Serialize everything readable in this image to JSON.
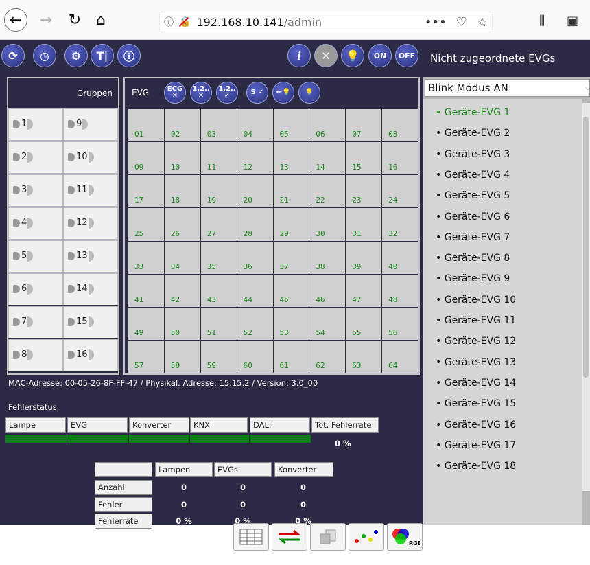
{
  "browser": {
    "url_host": "192.168.10.141",
    "url_path": "/admin",
    "actions": [
      "•••",
      "♡",
      "☆"
    ]
  },
  "toolbar": {
    "on_label": "ON",
    "off_label": "OFF",
    "info_label": "i"
  },
  "groups": {
    "header": "Gruppen",
    "items": [
      "1",
      "2",
      "3",
      "4",
      "5",
      "6",
      "7",
      "8",
      "9",
      "10",
      "11",
      "12",
      "13",
      "14",
      "15",
      "16"
    ]
  },
  "evg": {
    "label": "EVG",
    "tools": [
      "ECG ✕",
      "1,2.. ✕",
      "1,2.. ✓",
      "S ✓",
      "←💡",
      "💡"
    ],
    "cells": [
      "01",
      "02",
      "03",
      "04",
      "05",
      "06",
      "07",
      "08",
      "09",
      "10",
      "11",
      "12",
      "13",
      "14",
      "15",
      "16",
      "17",
      "18",
      "19",
      "20",
      "21",
      "22",
      "23",
      "24",
      "25",
      "26",
      "27",
      "28",
      "29",
      "30",
      "31",
      "32",
      "33",
      "34",
      "35",
      "36",
      "37",
      "38",
      "39",
      "40",
      "41",
      "42",
      "43",
      "44",
      "45",
      "46",
      "47",
      "48",
      "49",
      "50",
      "51",
      "52",
      "53",
      "54",
      "55",
      "56",
      "57",
      "58",
      "59",
      "60",
      "61",
      "62",
      "63",
      "64"
    ]
  },
  "info_line": "MAC-Adresse: 00-05-26-8F-FF-47 / Physikal. Adresse: 15.15.2 / Version: 3.0_00",
  "fehlerstatus": {
    "title": "Fehlerstatus",
    "columns": [
      "Lampe",
      "EVG",
      "Konverter",
      "KNX",
      "DALI",
      "Tot. Fehlerrate"
    ],
    "tot_value": "0 %"
  },
  "stats": {
    "columns": [
      "Lampen",
      "EVGs",
      "Konverter"
    ],
    "rows": [
      {
        "label": "Anzahl",
        "values": [
          "0",
          "0",
          "0"
        ]
      },
      {
        "label": "Fehler",
        "values": [
          "0",
          "0",
          "0"
        ]
      },
      {
        "label": "Fehlerrate",
        "values": [
          "0 %",
          "0 %",
          "0 %"
        ]
      }
    ]
  },
  "sidebar": {
    "title": "Nicht zugeordnete EVGs",
    "select_value": "Blink Modus AN",
    "items": [
      "Geräte-EVG 1",
      "Geräte-EVG 2",
      "Geräte-EVG 3",
      "Geräte-EVG 4",
      "Geräte-EVG 5",
      "Geräte-EVG 6",
      "Geräte-EVG 7",
      "Geräte-EVG 8",
      "Geräte-EVG 9",
      "Geräte-EVG 10",
      "Geräte-EVG 11",
      "Geräte-EVG 12",
      "Geräte-EVG 13",
      "Geräte-EVG 14",
      "Geräte-EVG 15",
      "Geräte-EVG 16",
      "Geräte-EVG 17",
      "Geräte-EVG 18"
    ],
    "active_color": "#1a8a1a"
  },
  "bottom_icons": [
    "table-icon",
    "swap-arrows-icon",
    "copy-icon",
    "dots-icon",
    "rgb-icon"
  ],
  "bottom_rgb_label": "RGB"
}
